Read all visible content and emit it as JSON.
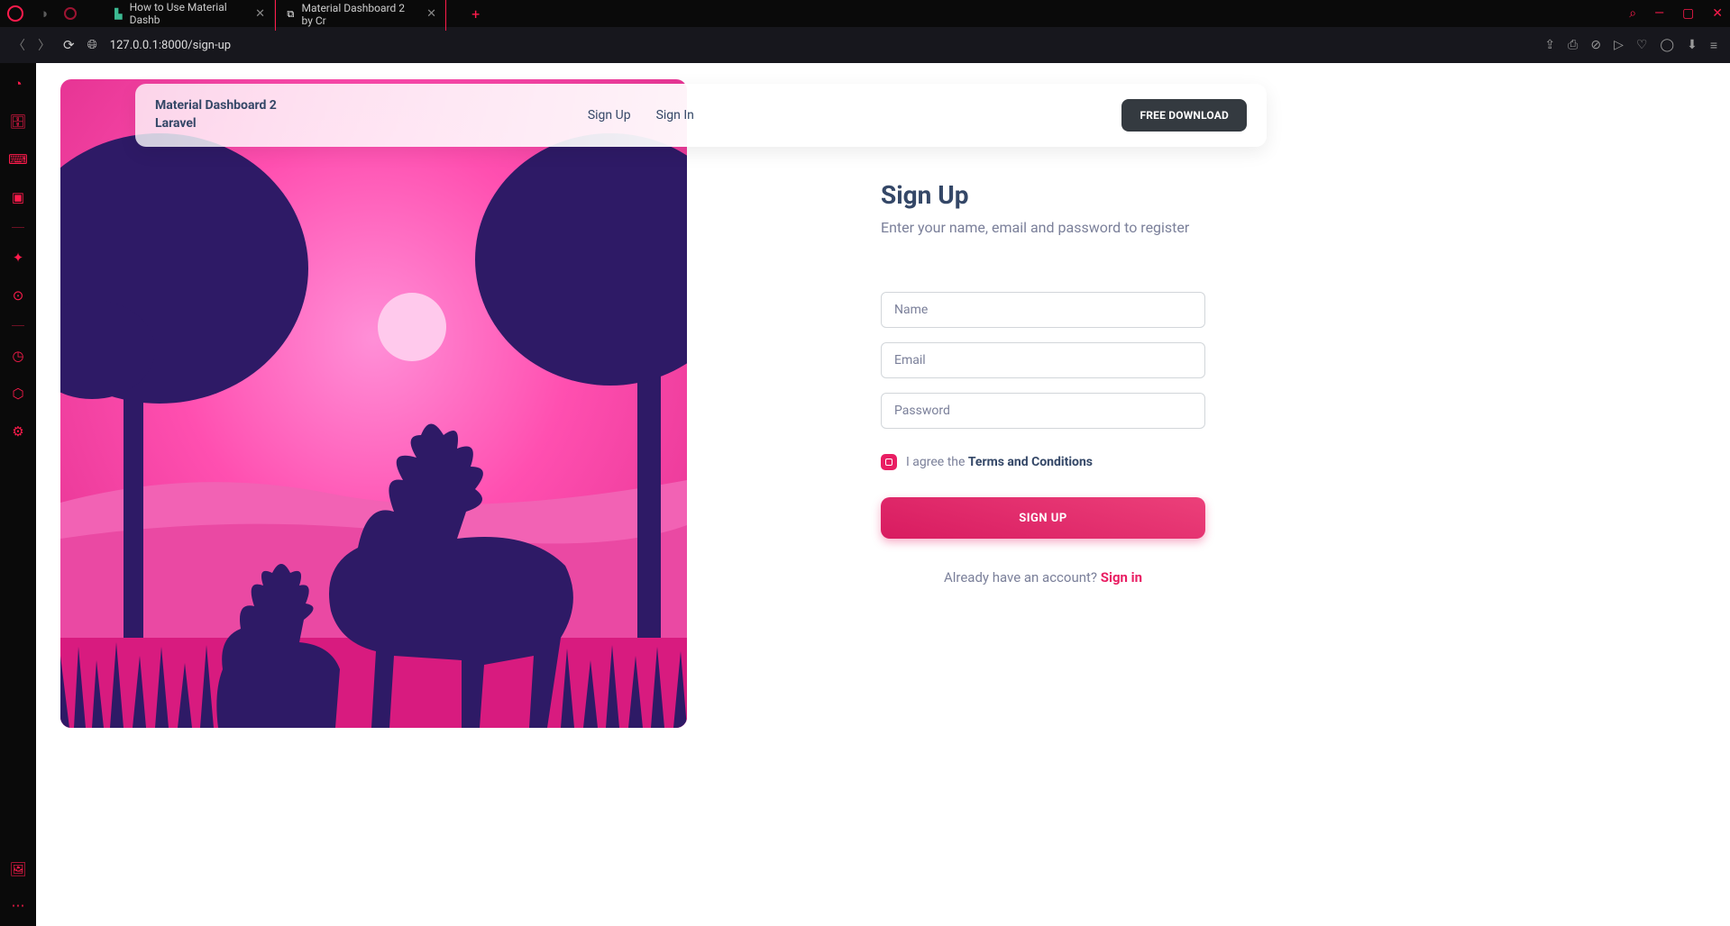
{
  "browser": {
    "tabs": [
      {
        "title": "How to Use Material Dashb"
      },
      {
        "title": "Material Dashboard 2 by Cr"
      }
    ],
    "url": "127.0.0.1:8000/sign-up"
  },
  "navbar": {
    "brand_line1": "Material Dashboard 2",
    "brand_line2": "Laravel",
    "links": {
      "signup": "Sign Up",
      "signin": "Sign In"
    },
    "download": "FREE DOWNLOAD"
  },
  "form": {
    "title": "Sign Up",
    "subtitle": "Enter your name, email and password to register",
    "name_ph": "Name",
    "email_ph": "Email",
    "password_ph": "Password",
    "agree_prefix": "I agree the ",
    "agree_terms": "Terms and Conditions",
    "submit": "SIGN UP",
    "already_prefix": "Already have an account? ",
    "already_link": "Sign in"
  }
}
